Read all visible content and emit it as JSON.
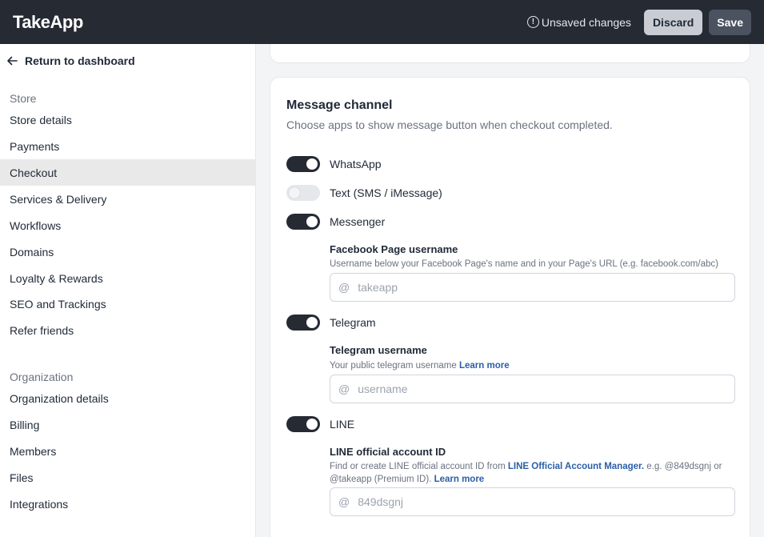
{
  "header": {
    "logo": "TakeApp",
    "unsaved_text": "Unsaved changes",
    "discard_label": "Discard",
    "save_label": "Save"
  },
  "sidebar": {
    "back_label": "Return to dashboard",
    "store_section": "Store",
    "store_items": [
      "Store details",
      "Payments",
      "Checkout",
      "Services & Delivery",
      "Workflows",
      "Domains",
      "Loyalty & Rewards",
      "SEO and Trackings",
      "Refer friends"
    ],
    "active_item": "Checkout",
    "org_section": "Organization",
    "org_items": [
      "Organization details",
      "Billing",
      "Members",
      "Files",
      "Integrations"
    ]
  },
  "message_channel": {
    "title": "Message channel",
    "subtitle": "Choose apps to show message button when checkout completed.",
    "channels": {
      "whatsapp": {
        "label": "WhatsApp",
        "enabled": true
      },
      "text": {
        "label": "Text (SMS / iMessage)",
        "enabled": false
      },
      "messenger": {
        "label": "Messenger",
        "enabled": true
      },
      "telegram": {
        "label": "Telegram",
        "enabled": true
      },
      "line": {
        "label": "LINE",
        "enabled": true
      }
    },
    "facebook": {
      "label": "Facebook Page username",
      "help": "Username below your Facebook Page's name and in your Page's URL (e.g. facebook.com/abc)",
      "prefix": "@",
      "placeholder": "takeapp",
      "value": ""
    },
    "telegram_field": {
      "label": "Telegram username",
      "help": "Your public telegram username",
      "help_link": "Learn more",
      "prefix": "@",
      "placeholder": "username",
      "value": ""
    },
    "line_field": {
      "label": "LINE official account ID",
      "help_pre": "Find or create LINE official account ID from",
      "help_link": "LINE Official Account Manager.",
      "help_post": "e.g. @849dsgnj or @takeapp (Premium ID).",
      "help_link2": "Learn more",
      "prefix": "@",
      "placeholder": "849dsgnj",
      "value": ""
    }
  }
}
